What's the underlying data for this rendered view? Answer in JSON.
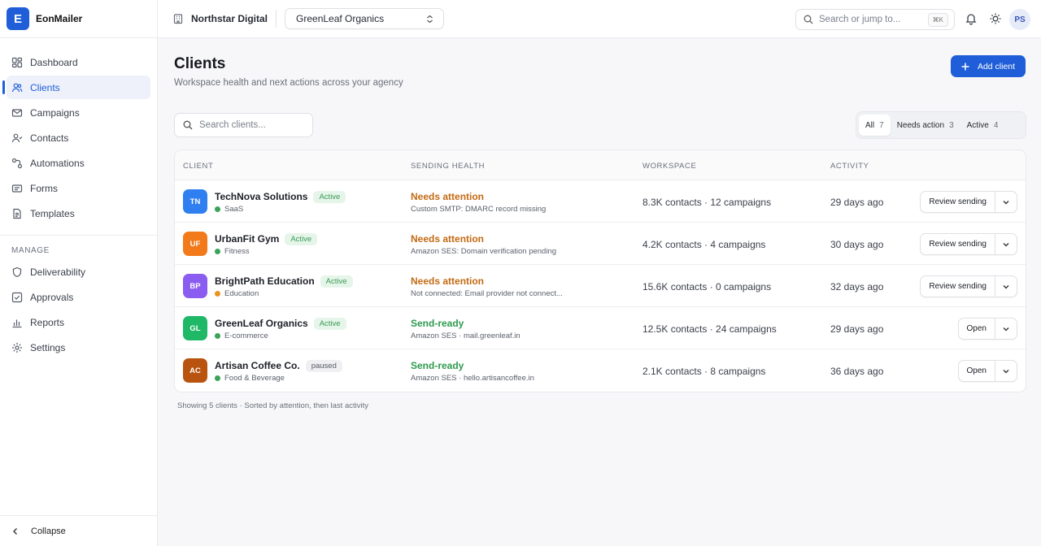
{
  "brand": {
    "logo_letter": "E",
    "name": "EonMailer",
    "accent": "#1f5ed8"
  },
  "sidebar": {
    "items": [
      {
        "label": "Dashboard",
        "icon": "dashboard-icon",
        "active": false
      },
      {
        "label": "Clients",
        "icon": "users-icon",
        "active": true
      },
      {
        "label": "Campaigns",
        "icon": "mail-icon",
        "active": false
      },
      {
        "label": "Contacts",
        "icon": "contacts-icon",
        "active": false
      },
      {
        "label": "Automations",
        "icon": "workflow-icon",
        "active": false
      },
      {
        "label": "Forms",
        "icon": "form-icon",
        "active": false
      },
      {
        "label": "Templates",
        "icon": "template-icon",
        "active": false
      }
    ],
    "manage_heading": "MANAGE",
    "manage_items": [
      {
        "label": "Deliverability",
        "icon": "shield-icon"
      },
      {
        "label": "Approvals",
        "icon": "check-square-icon"
      },
      {
        "label": "Reports",
        "icon": "bar-chart-icon"
      },
      {
        "label": "Settings",
        "icon": "gear-icon"
      }
    ],
    "collapse_label": "Collapse"
  },
  "topbar": {
    "org_name": "Northstar Digital",
    "workspace_select": "GreenLeaf Organics",
    "search_placeholder": "Search or jump to...",
    "search_shortcut": "⌘K",
    "user_initials": "PS"
  },
  "page": {
    "title": "Clients",
    "subtitle": "Workspace health and next actions across your agency",
    "add_button": "Add client",
    "search_placeholder": "Search clients...",
    "filters": [
      {
        "label": "All",
        "count": "7",
        "active": true
      },
      {
        "label": "Needs action",
        "count": "3",
        "active": false
      },
      {
        "label": "Active",
        "count": "4",
        "active": false
      }
    ]
  },
  "table": {
    "headers": {
      "client": "CLIENT",
      "health": "SENDING HEALTH",
      "workspace": "WORKSPACE",
      "activity": "ACTIVITY"
    },
    "rows": [
      {
        "initials": "TN",
        "avatar_color": "#2f7ff0",
        "name": "TechNova Solutions",
        "status": "Active",
        "status_type": "active",
        "category": "SaaS",
        "cat_color": "#3aa35a",
        "health": "Needs attention",
        "health_color": "#c26a12",
        "health_detail": "Custom SMTP: DMARC record missing",
        "workspace": "8.3K contacts · 12 campaigns",
        "activity": "29 days ago",
        "action": "Review sending"
      },
      {
        "initials": "UF",
        "avatar_color": "#f27a1a",
        "name": "UrbanFit Gym",
        "status": "Active",
        "status_type": "active",
        "category": "Fitness",
        "cat_color": "#3aa35a",
        "health": "Needs attention",
        "health_color": "#c26a12",
        "health_detail": "Amazon SES: Domain verification pending",
        "workspace": "4.2K contacts · 4 campaigns",
        "activity": "30 days ago",
        "action": "Review sending"
      },
      {
        "initials": "BP",
        "avatar_color": "#8b5cf0",
        "name": "BrightPath Education",
        "status": "Active",
        "status_type": "active",
        "category": "Education",
        "cat_color": "#e8951f",
        "health": "Needs attention",
        "health_color": "#c26a12",
        "health_detail": "Not connected: Email provider not connect...",
        "workspace": "15.6K contacts · 0 campaigns",
        "activity": "32 days ago",
        "action": "Review sending"
      },
      {
        "initials": "GL",
        "avatar_color": "#1fb866",
        "name": "GreenLeaf Organics",
        "status": "Active",
        "status_type": "active",
        "category": "E-commerce",
        "cat_color": "#3aa35a",
        "health": "Send-ready",
        "health_color": "#2e9a4f",
        "health_detail": "Amazon SES · mail.greenleaf.in",
        "workspace": "12.5K contacts · 24 campaigns",
        "activity": "29 days ago",
        "action": "Open"
      },
      {
        "initials": "AC",
        "avatar_color": "#b8540f",
        "name": "Artisan Coffee Co.",
        "status": "paused",
        "status_type": "paused",
        "category": "Food & Beverage",
        "cat_color": "#3aa35a",
        "health": "Send-ready",
        "health_color": "#2e9a4f",
        "health_detail": "Amazon SES · hello.artisancoffee.in",
        "workspace": "2.1K contacts · 8 campaigns",
        "activity": "36 days ago",
        "action": "Open"
      }
    ]
  },
  "footnote": "Showing 5 clients · Sorted by attention, then last activity"
}
